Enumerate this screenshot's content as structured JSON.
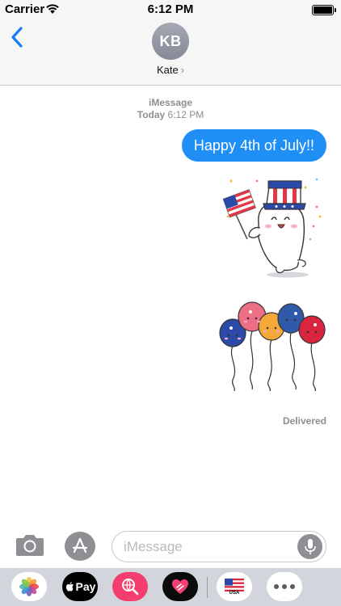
{
  "status_bar": {
    "carrier": "Carrier",
    "time": "6:12 PM"
  },
  "header": {
    "avatar_initials": "KB",
    "contact_name": "Kate",
    "contact_chevron": "›"
  },
  "thread": {
    "service": "iMessage",
    "timestamp_day": "Today",
    "timestamp_time": "6:12 PM",
    "messages": [
      {
        "type": "text",
        "text": "Happy 4th of July!!"
      },
      {
        "type": "sticker",
        "name": "uncle-sam-hat-cat-with-flag-sticker"
      },
      {
        "type": "sticker",
        "name": "cute-balloons-sticker"
      }
    ],
    "delivery_status": "Delivered"
  },
  "input_bar": {
    "placeholder": "iMessage"
  },
  "app_drawer": {
    "apple_pay_label": "Pay",
    "flag_app_label": "USA",
    "apps": [
      "photos-icon",
      "apple-pay-icon",
      "web-search-icon",
      "digital-touch-heart-icon",
      "usa-flag-icon",
      "more-icon"
    ]
  },
  "colors": {
    "bubble": "#1f8ff6",
    "accent": "#1a7cf5",
    "avatar": "#8f929d",
    "strip": "#d2d5db"
  }
}
